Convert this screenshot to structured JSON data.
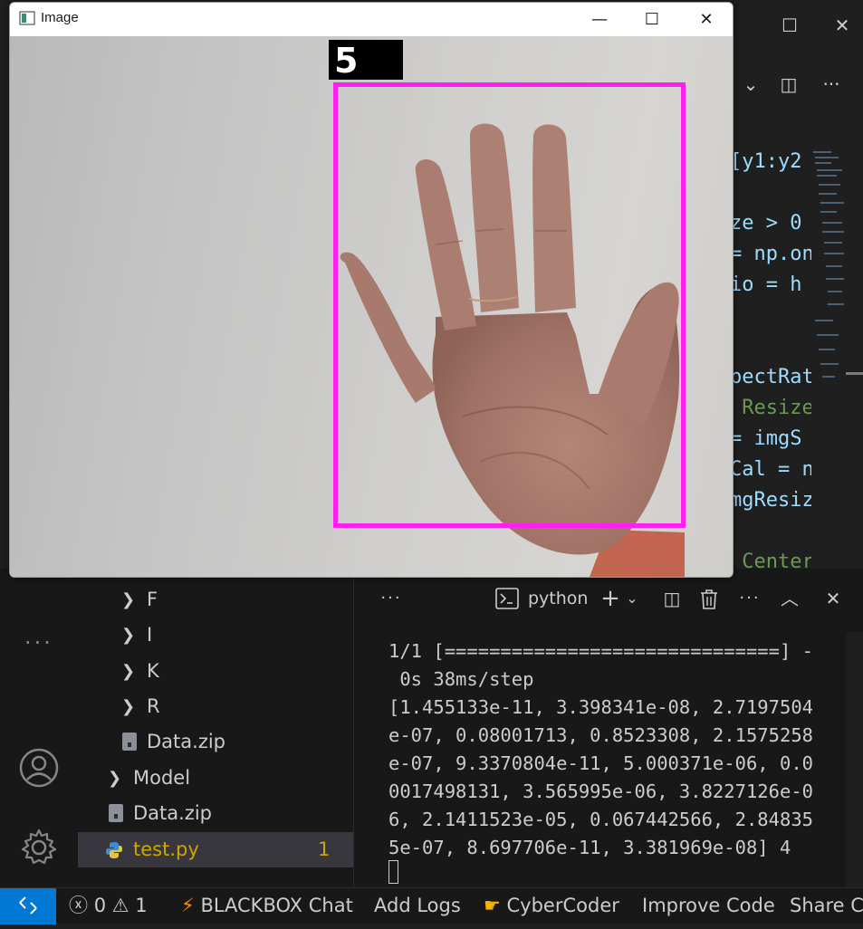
{
  "vscode": {
    "window_controls": {
      "minimize": "—",
      "maximize": "☐",
      "close": "✕"
    },
    "editor_toolbar": {
      "dropdown": "⌄",
      "split": "◫",
      "more": "···"
    },
    "code_fragments": [
      {
        "text": "[y1:y2",
        "color": "#9cdcfe"
      },
      {
        "text": "ze > 0",
        "color": "#9cdcfe"
      },
      {
        "text": "= np.on",
        "color": "#9cdcfe"
      },
      {
        "text": "io = h",
        "color": "#9cdcfe"
      },
      {
        "text": "pectRat",
        "color": "#9cdcfe"
      },
      {
        "text": " Resize",
        "color": "#6a9955"
      },
      {
        "text": "= imgS",
        "color": "#9cdcfe"
      },
      {
        "text": "Cal = n",
        "color": "#9cdcfe"
      },
      {
        "text": "mgResiz",
        "color": "#9cdcfe"
      },
      {
        "text": " Center",
        "color": "#6a9955"
      }
    ]
  },
  "explorer": {
    "items": [
      {
        "label": "F",
        "type": "folder"
      },
      {
        "label": "I",
        "type": "folder"
      },
      {
        "label": "K",
        "type": "folder"
      },
      {
        "label": "R",
        "type": "folder"
      },
      {
        "label": "Data.zip",
        "type": "file"
      },
      {
        "label": "Model",
        "type": "folder"
      },
      {
        "label": "Data.zip",
        "type": "file"
      },
      {
        "label": "test.py",
        "type": "python",
        "badge": "1"
      }
    ]
  },
  "terminal": {
    "shell_label": "python",
    "output_lines": [
      "1/1 [==============================] -",
      " 0s 38ms/step",
      "[1.455133e-11, 3.398341e-08, 2.7197504",
      "e-07, 0.08001713, 0.8523308, 2.1575258",
      "e-07, 9.3370804e-11, 5.000371e-06, 0.0",
      "0017498131, 3.565995e-06, 3.8227126e-0",
      "6, 2.1411523e-05, 0.067442566, 2.84835",
      "5e-07, 8.697706e-11, 3.381969e-08] 4"
    ]
  },
  "status_bar": {
    "errors": "0",
    "warnings": "1",
    "blackbox": "BLACKBOX Chat",
    "add_logs": "Add Logs",
    "cybercoder": "CyberCoder",
    "improve_code": "Improve Code",
    "share": "Share Co"
  },
  "image_window": {
    "title": "Image",
    "prediction": "5",
    "box_color": "#ff1ff1"
  }
}
